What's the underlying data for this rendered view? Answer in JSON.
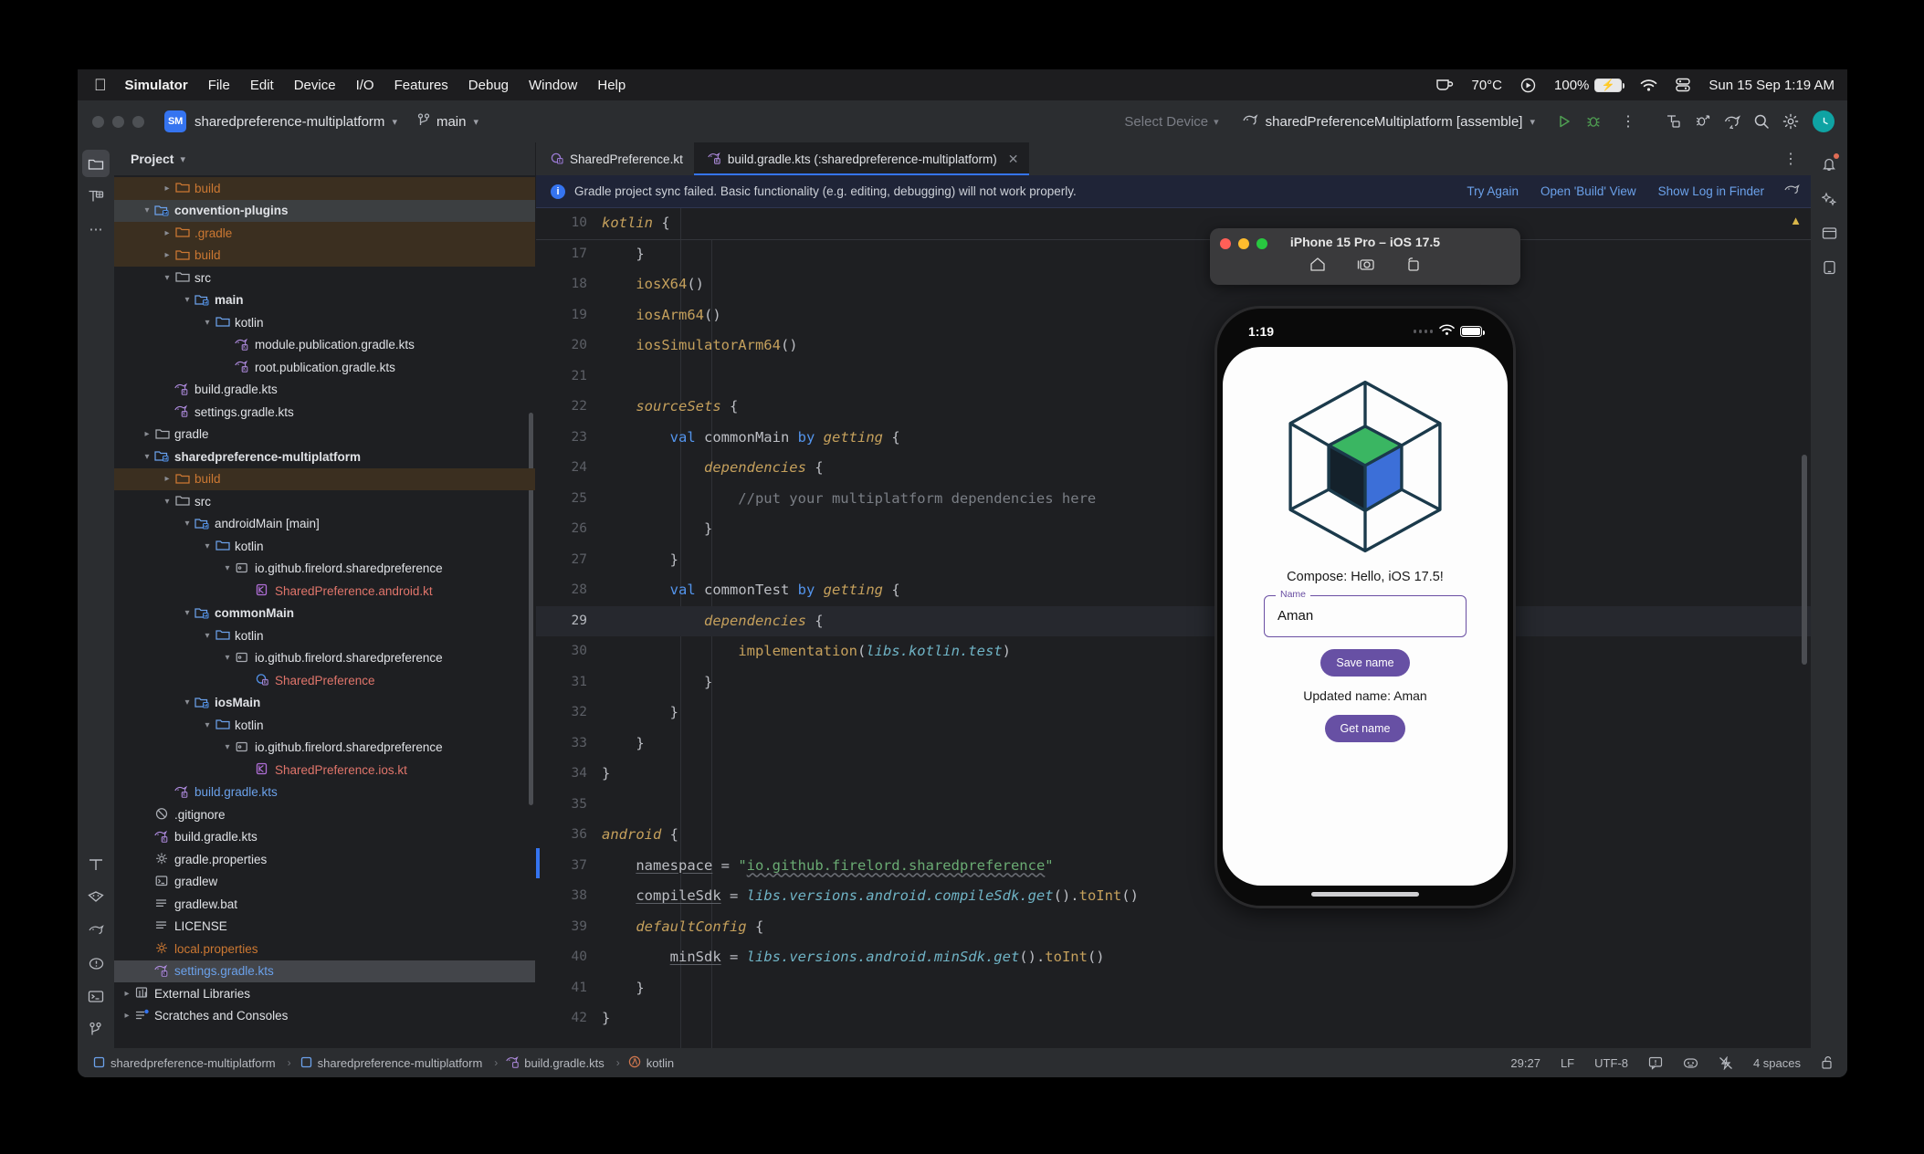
{
  "menubar": {
    "apple_icon": "apple-icon",
    "items": [
      {
        "label": "Simulator",
        "bold": true
      },
      {
        "label": "File",
        "bold": false
      },
      {
        "label": "Edit",
        "bold": false
      },
      {
        "label": "Device",
        "bold": false
      },
      {
        "label": "I/O",
        "bold": false
      },
      {
        "label": "Features",
        "bold": false
      },
      {
        "label": "Debug",
        "bold": false
      },
      {
        "label": "Window",
        "bold": false
      },
      {
        "label": "Help",
        "bold": false
      }
    ],
    "status": {
      "coffee_icon": "coffee-cup-icon",
      "temperature": "70°C",
      "record_icon": "record-icon",
      "battery_percent": "100%",
      "battery_charging_icon": "battery-charging-icon",
      "wifi_icon": "wifi-icon",
      "control_center_icon": "control-center-icon",
      "clock": "Sun 15 Sep  1:19 AM"
    }
  },
  "ide": {
    "toolbar": {
      "project_badge": "SM",
      "project_name": "sharedpreference-multiplatform",
      "branch_icon": "branch-icon",
      "branch_name": "main",
      "device_selector": "Select Device",
      "run_config": "sharedPreferenceMultiplatform [assemble]",
      "run_icon": "run-icon",
      "debug_icon": "debug-icon",
      "more_icon": "more-vertical-icon",
      "icons": [
        "code-with-me-icon",
        "bug-arrow-icon",
        "gradle-icon",
        "search-icon",
        "settings-gear-icon"
      ],
      "avatar": "user-avatar"
    },
    "rail_top": [
      "project-folder-icon",
      "structure-icon",
      "more-dots-icon"
    ],
    "rail_bottom": [
      "structure-icon",
      "database-icon",
      "gradle-icon",
      "problems-icon",
      "terminal-icon",
      "version-control-icon"
    ],
    "right_rail": [
      "notifications-icon",
      "ai-assistant-icon",
      "preview-icon",
      "device-manager-icon"
    ],
    "project_panel": {
      "title": "Project",
      "chevron": "chevron-down-icon",
      "tree": [
        {
          "depth": 2,
          "arrow": "›",
          "icon": "folder",
          "icon_color": "orange",
          "label": "build",
          "color": "orange",
          "bold": false,
          "state": "build"
        },
        {
          "depth": 1,
          "arrow": "⌄",
          "icon": "module",
          "icon_color": "blue",
          "label": "convention-plugins",
          "color": "white",
          "bold": true,
          "state": "row"
        },
        {
          "depth": 2,
          "arrow": "›",
          "icon": "folder",
          "icon_color": "orange",
          "label": ".gradle",
          "color": "orange",
          "bold": false,
          "state": "build"
        },
        {
          "depth": 2,
          "arrow": "›",
          "icon": "folder",
          "icon_color": "orange",
          "label": "build",
          "color": "orange",
          "bold": false,
          "state": "build"
        },
        {
          "depth": 2,
          "arrow": "⌄",
          "icon": "folder",
          "icon_color": "gray",
          "label": "src",
          "color": "white",
          "bold": false,
          "state": "none"
        },
        {
          "depth": 3,
          "arrow": "⌄",
          "icon": "module",
          "icon_color": "blue",
          "label": "main",
          "color": "white",
          "bold": true,
          "state": "none"
        },
        {
          "depth": 4,
          "arrow": "⌄",
          "icon": "folder",
          "icon_color": "blue",
          "label": "kotlin",
          "color": "white",
          "bold": false,
          "state": "none"
        },
        {
          "depth": 5,
          "arrow": "",
          "icon": "gradlekts",
          "icon_color": "purple",
          "label": "module.publication.gradle.kts",
          "color": "white",
          "bold": false,
          "state": "none"
        },
        {
          "depth": 5,
          "arrow": "",
          "icon": "gradlekts",
          "icon_color": "purple",
          "label": "root.publication.gradle.kts",
          "color": "white",
          "bold": false,
          "state": "none"
        },
        {
          "depth": 2,
          "arrow": "",
          "icon": "gradlekts",
          "icon_color": "purple",
          "label": "build.gradle.kts",
          "color": "white",
          "bold": false,
          "state": "none"
        },
        {
          "depth": 2,
          "arrow": "",
          "icon": "gradlekts",
          "icon_color": "purple",
          "label": "settings.gradle.kts",
          "color": "white",
          "bold": false,
          "state": "none"
        },
        {
          "depth": 1,
          "arrow": "›",
          "icon": "folder",
          "icon_color": "gray",
          "label": "gradle",
          "color": "white",
          "bold": false,
          "state": "none"
        },
        {
          "depth": 1,
          "arrow": "⌄",
          "icon": "module",
          "icon_color": "blue",
          "label": "sharedpreference-multiplatform",
          "color": "white",
          "bold": true,
          "state": "none"
        },
        {
          "depth": 2,
          "arrow": "›",
          "icon": "folder",
          "icon_color": "orange",
          "label": "build",
          "color": "orange",
          "bold": false,
          "state": "build"
        },
        {
          "depth": 2,
          "arrow": "⌄",
          "icon": "folder",
          "icon_color": "gray",
          "label": "src",
          "color": "white",
          "bold": false,
          "state": "none"
        },
        {
          "depth": 3,
          "arrow": "⌄",
          "icon": "module",
          "icon_color": "blue",
          "label": "androidMain [main]",
          "color": "white",
          "bold": false,
          "state": "none"
        },
        {
          "depth": 4,
          "arrow": "⌄",
          "icon": "folder",
          "icon_color": "blue",
          "label": "kotlin",
          "color": "white",
          "bold": false,
          "state": "none"
        },
        {
          "depth": 5,
          "arrow": "⌄",
          "icon": "package",
          "icon_color": "gray",
          "label": "io.github.firelord.sharedpreference",
          "color": "white",
          "bold": false,
          "state": "none"
        },
        {
          "depth": 6,
          "arrow": "",
          "icon": "kotlinfile",
          "icon_color": "purple",
          "label": "SharedPreference.android.kt",
          "color": "red",
          "bold": false,
          "state": "none"
        },
        {
          "depth": 3,
          "arrow": "⌄",
          "icon": "module",
          "icon_color": "blue",
          "label": "commonMain",
          "color": "white",
          "bold": true,
          "state": "none"
        },
        {
          "depth": 4,
          "arrow": "⌄",
          "icon": "folder",
          "icon_color": "blue",
          "label": "kotlin",
          "color": "white",
          "bold": false,
          "state": "none"
        },
        {
          "depth": 5,
          "arrow": "⌄",
          "icon": "package",
          "icon_color": "gray",
          "label": "io.github.firelord.sharedpreference",
          "color": "white",
          "bold": false,
          "state": "none"
        },
        {
          "depth": 6,
          "arrow": "",
          "icon": "kotlinclass",
          "icon_color": "purple",
          "label": "SharedPreference",
          "color": "red",
          "bold": false,
          "state": "none"
        },
        {
          "depth": 3,
          "arrow": "⌄",
          "icon": "module",
          "icon_color": "blue",
          "label": "iosMain",
          "color": "white",
          "bold": true,
          "state": "none"
        },
        {
          "depth": 4,
          "arrow": "⌄",
          "icon": "folder",
          "icon_color": "blue",
          "label": "kotlin",
          "color": "white",
          "bold": false,
          "state": "none"
        },
        {
          "depth": 5,
          "arrow": "⌄",
          "icon": "package",
          "icon_color": "gray",
          "label": "io.github.firelord.sharedpreference",
          "color": "white",
          "bold": false,
          "state": "none"
        },
        {
          "depth": 6,
          "arrow": "",
          "icon": "kotlinfile",
          "icon_color": "purple",
          "label": "SharedPreference.ios.kt",
          "color": "red",
          "bold": false,
          "state": "none"
        },
        {
          "depth": 2,
          "arrow": "",
          "icon": "gradlekts",
          "icon_color": "purple",
          "label": "build.gradle.kts",
          "color": "blue",
          "bold": false,
          "state": "none"
        },
        {
          "depth": 1,
          "arrow": "",
          "icon": "gitignore",
          "icon_color": "gray",
          "label": ".gitignore",
          "color": "white",
          "bold": false,
          "state": "none"
        },
        {
          "depth": 1,
          "arrow": "",
          "icon": "gradlekts",
          "icon_color": "purple",
          "label": "build.gradle.kts",
          "color": "white",
          "bold": false,
          "state": "none"
        },
        {
          "depth": 1,
          "arrow": "",
          "icon": "properties",
          "icon_color": "gray",
          "label": "gradle.properties",
          "color": "white",
          "bold": false,
          "state": "none"
        },
        {
          "depth": 1,
          "arrow": "",
          "icon": "shell",
          "icon_color": "gray",
          "label": "gradlew",
          "color": "white",
          "bold": false,
          "state": "none"
        },
        {
          "depth": 1,
          "arrow": "",
          "icon": "textfile",
          "icon_color": "gray",
          "label": "gradlew.bat",
          "color": "white",
          "bold": false,
          "state": "none"
        },
        {
          "depth": 1,
          "arrow": "",
          "icon": "textfile",
          "icon_color": "gray",
          "label": "LICENSE",
          "color": "white",
          "bold": false,
          "state": "none"
        },
        {
          "depth": 1,
          "arrow": "",
          "icon": "properties",
          "icon_color": "orange",
          "label": "local.properties",
          "color": "orange",
          "bold": false,
          "state": "none"
        },
        {
          "depth": 1,
          "arrow": "",
          "icon": "gradlekts",
          "icon_color": "purple",
          "label": "settings.gradle.kts",
          "color": "blue",
          "bold": false,
          "state": "focus"
        },
        {
          "depth": 0,
          "arrow": "›",
          "icon": "library",
          "icon_color": "gray",
          "label": "External Libraries",
          "color": "white",
          "bold": false,
          "state": "none"
        },
        {
          "depth": 0,
          "arrow": "›",
          "icon": "scratches",
          "icon_color": "gray",
          "label": "Scratches and Consoles",
          "color": "white",
          "bold": false,
          "state": "none"
        }
      ]
    },
    "tabs": [
      {
        "label": "SharedPreference.kt",
        "icon": "kotlin-class-icon",
        "active": false,
        "closable": false
      },
      {
        "label": "build.gradle.kts (:sharedpreference-multiplatform)",
        "icon": "gradle-kts-icon",
        "active": true,
        "closable": true
      }
    ],
    "banner": {
      "icon": "info-icon",
      "message": "Gradle project sync failed. Basic functionality (e.g. editing, debugging) will not work properly.",
      "actions": [
        "Try Again",
        "Open 'Build' View",
        "Show Log in Finder"
      ],
      "trailing_icon": "gradle-icon"
    },
    "code_lines": [
      {
        "num": "10",
        "text": "kotlin {",
        "cur": false,
        "fold_after": true,
        "changed": false
      },
      {
        "num": "17",
        "text": "    }",
        "cur": false,
        "fold_after": false,
        "changed": false
      },
      {
        "num": "18",
        "text": "    iosX64()",
        "cur": false,
        "fold_after": false,
        "changed": false
      },
      {
        "num": "19",
        "text": "    iosArm64()",
        "cur": false,
        "fold_after": false,
        "changed": false
      },
      {
        "num": "20",
        "text": "    iosSimulatorArm64()",
        "cur": false,
        "fold_after": false,
        "changed": false
      },
      {
        "num": "21",
        "text": "",
        "cur": false,
        "fold_after": false,
        "changed": false
      },
      {
        "num": "22",
        "text": "    sourceSets {",
        "cur": false,
        "fold_after": false,
        "changed": false
      },
      {
        "num": "23",
        "text": "        val commonMain by getting {",
        "cur": false,
        "fold_after": false,
        "changed": false
      },
      {
        "num": "24",
        "text": "            dependencies {",
        "cur": false,
        "fold_after": false,
        "changed": false
      },
      {
        "num": "25",
        "text": "                //put your multiplatform dependencies here",
        "cur": false,
        "fold_after": false,
        "changed": false
      },
      {
        "num": "26",
        "text": "            }",
        "cur": false,
        "fold_after": false,
        "changed": false
      },
      {
        "num": "27",
        "text": "        }",
        "cur": false,
        "fold_after": false,
        "changed": false
      },
      {
        "num": "28",
        "text": "        val commonTest by getting {",
        "cur": false,
        "fold_after": false,
        "changed": false
      },
      {
        "num": "29",
        "text": "            dependencies {",
        "cur": true,
        "fold_after": false,
        "changed": false
      },
      {
        "num": "30",
        "text": "                implementation(libs.kotlin.test)",
        "cur": false,
        "fold_after": false,
        "changed": false
      },
      {
        "num": "31",
        "text": "            }",
        "cur": false,
        "fold_after": false,
        "changed": false
      },
      {
        "num": "32",
        "text": "        }",
        "cur": false,
        "fold_after": false,
        "changed": false
      },
      {
        "num": "33",
        "text": "    }",
        "cur": false,
        "fold_after": false,
        "changed": false
      },
      {
        "num": "34",
        "text": "}",
        "cur": false,
        "fold_after": false,
        "changed": false
      },
      {
        "num": "35",
        "text": "",
        "cur": false,
        "fold_after": false,
        "changed": false
      },
      {
        "num": "36",
        "text": "android {",
        "cur": false,
        "fold_after": false,
        "changed": false
      },
      {
        "num": "37",
        "text": "    namespace = \"io.github.firelord.sharedpreference\"",
        "cur": false,
        "fold_after": false,
        "changed": true
      },
      {
        "num": "38",
        "text": "    compileSdk = libs.versions.android.compileSdk.get().toInt()",
        "cur": false,
        "fold_after": false,
        "changed": false
      },
      {
        "num": "39",
        "text": "    defaultConfig {",
        "cur": false,
        "fold_after": false,
        "changed": false
      },
      {
        "num": "40",
        "text": "        minSdk = libs.versions.android.minSdk.get().toInt()",
        "cur": false,
        "fold_after": false,
        "changed": false
      },
      {
        "num": "41",
        "text": "    }",
        "cur": false,
        "fold_after": false,
        "changed": false
      },
      {
        "num": "42",
        "text": "}",
        "cur": false,
        "fold_after": false,
        "changed": false
      }
    ],
    "statusbar": {
      "breadcrumbs": [
        {
          "label": "sharedpreference-multiplatform",
          "icon": "module-icon"
        },
        {
          "label": "sharedpreference-multiplatform",
          "icon": "module-icon"
        },
        {
          "label": "build.gradle.kts",
          "icon": "gradle-kts-icon"
        },
        {
          "label": "kotlin",
          "icon": "lambda-icon"
        }
      ],
      "caret": "29:27",
      "line_ending": "LF",
      "encoding": "UTF-8",
      "memory_icon": "inspection-icon",
      "assistant_icon": "ai-icon",
      "power_save_icon": "power-save-icon",
      "indent": "4 spaces",
      "lock_icon": "unlocked-icon"
    }
  },
  "simulator": {
    "title": "iPhone 15 Pro – iOS 17.5",
    "window_buttons": {
      "close": "#ff5f57",
      "minimize": "#febc2e",
      "zoom": "#28c840"
    },
    "toolbar_icons": [
      "home-icon",
      "screenshot-icon",
      "rotate-icon"
    ],
    "status": {
      "time": "1:19",
      "cellular_icon": "cellular-dots-icon",
      "wifi_icon": "wifi-icon",
      "battery_icon": "battery-full-icon"
    },
    "app": {
      "logo": "kotlin-multiplatform-cube-logo",
      "hello_text": "Compose: Hello, iOS 17.5!",
      "field_label": "Name",
      "field_value": "Aman",
      "save_button": "Save name",
      "updated_text": "Updated name: Aman",
      "get_button": "Get name",
      "accent_color": "#6750a4"
    }
  }
}
